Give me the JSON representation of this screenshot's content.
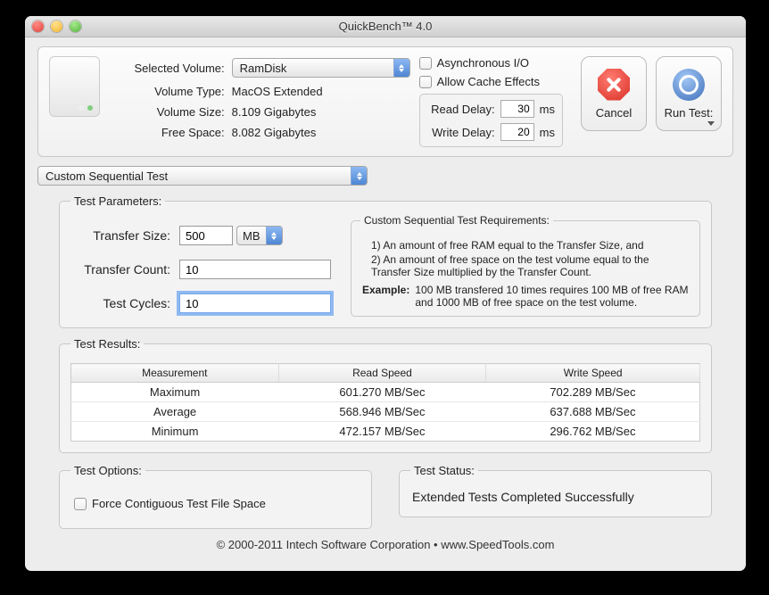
{
  "window": {
    "title": "QuickBench™ 4.0"
  },
  "volume": {
    "selected_label": "Selected Volume:",
    "selected_value": "RamDisk",
    "type_label": "Volume Type:",
    "type_value": "MacOS Extended",
    "size_label": "Volume Size:",
    "size_value": "8.109 Gigabytes",
    "free_label": "Free Space:",
    "free_value": "8.082 Gigabytes"
  },
  "options": {
    "async_label": "Asynchronous I/O",
    "cache_label": "Allow Cache Effects",
    "read_delay_label": "Read Delay:",
    "read_delay_value": "30",
    "write_delay_label": "Write Delay:",
    "write_delay_value": "20",
    "ms": "ms"
  },
  "buttons": {
    "cancel": "Cancel",
    "run": "Run Test:"
  },
  "test_mode": "Custom Sequential Test",
  "params": {
    "legend": "Test Parameters:",
    "transfer_size_label": "Transfer Size:",
    "transfer_size_value": "500",
    "transfer_size_unit": "MB",
    "transfer_count_label": "Transfer Count:",
    "transfer_count_value": "10",
    "test_cycles_label": "Test Cycles:",
    "test_cycles_value": "10",
    "req_title": "Custom Sequential Test Requirements:",
    "req1": "1) An amount of free RAM equal to the Transfer Size, and",
    "req2": "2) An amount of free space on the test volume equal to the Transfer Size multiplied by the Transfer Count.",
    "example_label": "Example:",
    "example_text": "100 MB transfered 10 times requires 100 MB of free RAM and 1000 MB of free space on the test volume."
  },
  "results": {
    "legend": "Test Results:",
    "headers": {
      "measurement": "Measurement",
      "read": "Read Speed",
      "write": "Write Speed"
    },
    "rows": [
      {
        "m": "Maximum",
        "r": "601.270 MB/Sec",
        "w": "702.289 MB/Sec"
      },
      {
        "m": "Average",
        "r": "568.946 MB/Sec",
        "w": "637.688 MB/Sec"
      },
      {
        "m": "Minimum",
        "r": "472.157 MB/Sec",
        "w": "296.762 MB/Sec"
      }
    ]
  },
  "test_options": {
    "legend": "Test Options:",
    "force_contig": "Force Contiguous Test File Space"
  },
  "test_status": {
    "legend": "Test Status:",
    "text": "Extended Tests Completed Successfully"
  },
  "footer": "© 2000-2011 Intech Software Corporation • www.SpeedTools.com"
}
